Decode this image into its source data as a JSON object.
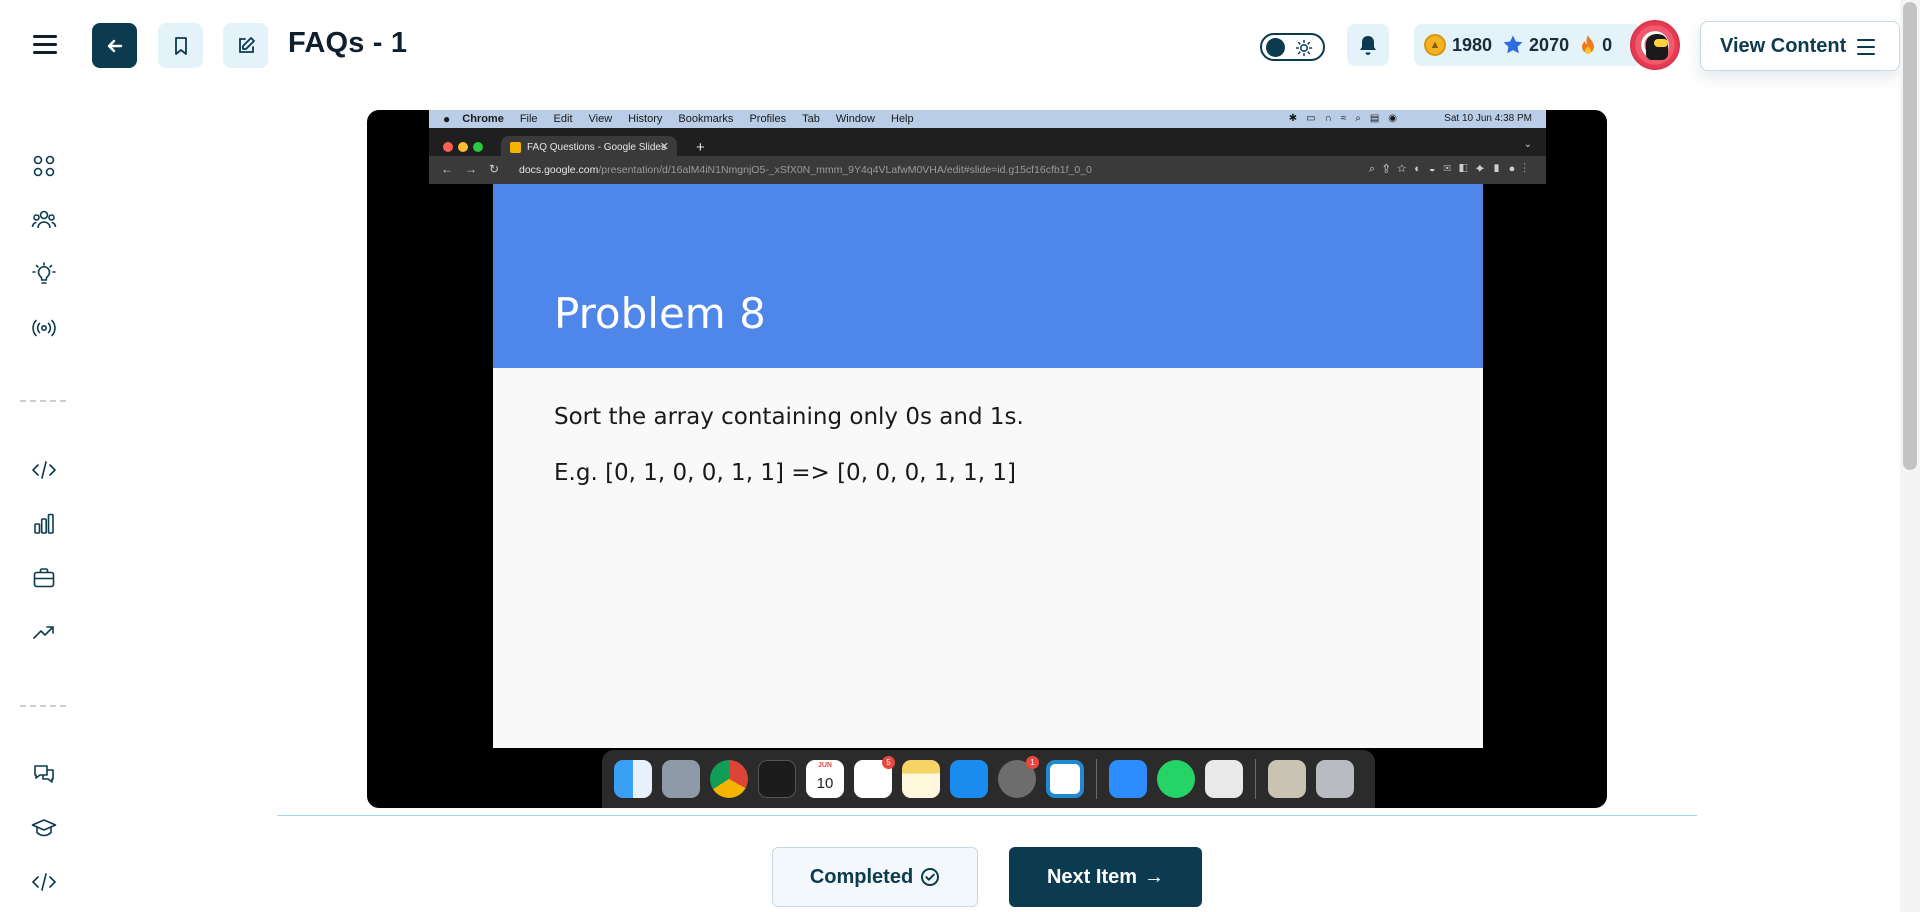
{
  "header": {
    "title": "FAQs - 1",
    "stats": {
      "coins": "1980",
      "stars": "2070",
      "streak": "0"
    },
    "view_content_label": "View Content"
  },
  "sidebar": {
    "items": [
      "grid-icon",
      "users-icon",
      "lightbulb-icon",
      "broadcast-icon",
      "code-icon",
      "bar-chart-icon",
      "briefcase-icon",
      "trending-icon",
      "chat-icon",
      "graduation-cap-icon",
      "code-icon"
    ]
  },
  "video": {
    "mac_menubar": {
      "app": "Chrome",
      "menus": [
        "File",
        "Edit",
        "View",
        "History",
        "Bookmarks",
        "Profiles",
        "Tab",
        "Window",
        "Help"
      ],
      "clock": "Sat 10 Jun  4:38 PM"
    },
    "browser": {
      "tab_title": "FAQ Questions - Google Slides",
      "url_host": "docs.google.com",
      "url_path": "/presentation/d/16alM4iN1NmgnjO5-_xSfX0N_mmm_9Y4q4VLafwM0VHA/edit#slide=id.g15cf16cfb1f_0_0"
    },
    "slide": {
      "title": "Problem 8",
      "line1": "Sort the array containing only 0s and 1s.",
      "line2": "E.g. [0, 1, 0, 0, 1, 1] => [0, 0, 0, 1, 1, 1]"
    },
    "dock": {
      "calendar_month": "JUN",
      "calendar_day": "10",
      "reminders_badge": "5",
      "settings_badge": "1"
    }
  },
  "footer": {
    "completed_label": "Completed",
    "next_label": "Next Item",
    "next_arrow": "→"
  },
  "colors": {
    "primary": "#0c3a4f",
    "light_accent": "#e4f3f9",
    "slide_header": "#4f86ea"
  }
}
